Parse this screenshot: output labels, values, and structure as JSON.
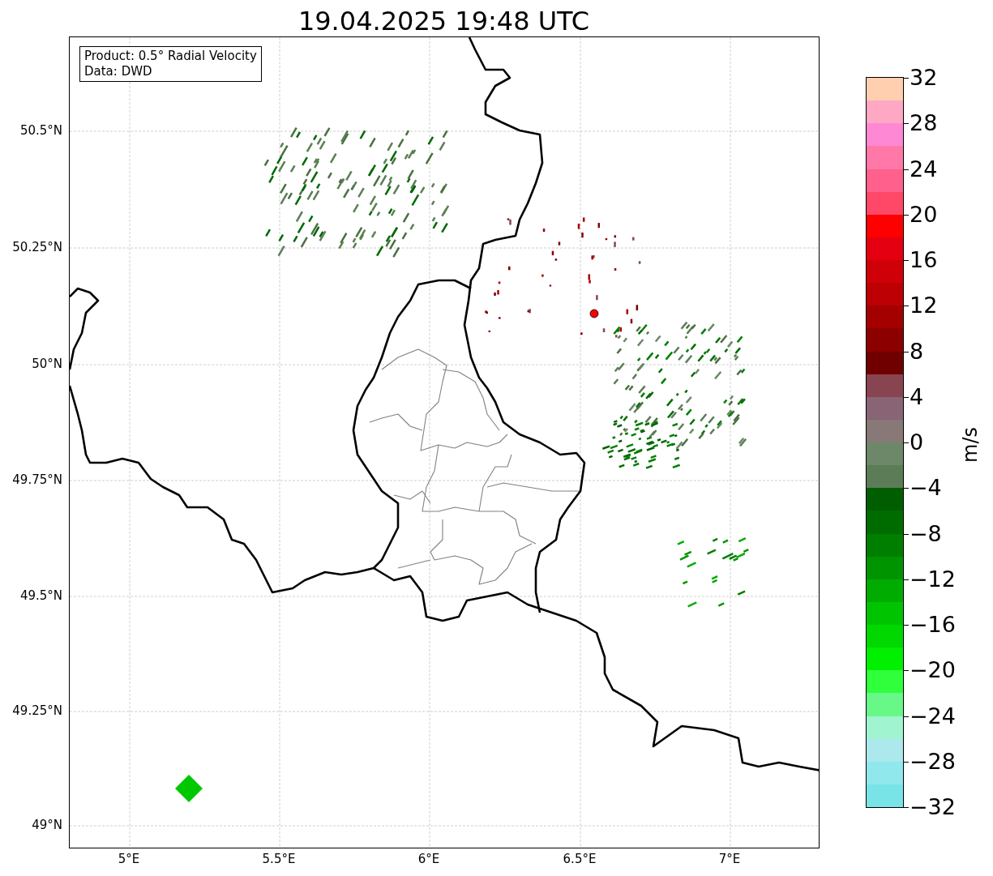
{
  "title": "19.04.2025 19:48 UTC",
  "info_box": [
    "Product: 0.5° Radial Velocity",
    "Data: DWD"
  ],
  "lat_ticks": [
    "50.5°N",
    "50.25°N",
    "50°N",
    "49.75°N",
    "49.5°N",
    "49.25°N",
    "49°N"
  ],
  "lon_ticks": [
    "5°E",
    "5.5°E",
    "6°E",
    "6.5°E",
    "7°E"
  ],
  "colorbar": {
    "label": "m/s",
    "ticks": [
      "32",
      "28",
      "24",
      "20",
      "16",
      "12",
      "8",
      "4",
      "0",
      "−4",
      "−8",
      "−12",
      "−16",
      "−20",
      "−24",
      "−28",
      "−32"
    ],
    "bins": [
      {
        "color": "#ffcfb0"
      },
      {
        "color": "#ffa8c4"
      },
      {
        "color": "#ff88d4"
      },
      {
        "color": "#ff78a8"
      },
      {
        "color": "#ff608c"
      },
      {
        "color": "#ff4868"
      },
      {
        "color": "#ff0000"
      },
      {
        "color": "#e40010"
      },
      {
        "color": "#d00008"
      },
      {
        "color": "#bc0004"
      },
      {
        "color": "#a40000"
      },
      {
        "color": "#8c0000"
      },
      {
        "color": "#700000"
      },
      {
        "color": "#884450"
      },
      {
        "color": "#886474"
      },
      {
        "color": "#887878"
      },
      {
        "color": "#6c8868"
      },
      {
        "color": "#5c7c58"
      },
      {
        "color": "#005e00"
      },
      {
        "color": "#006c00"
      },
      {
        "color": "#007e00"
      },
      {
        "color": "#009400"
      },
      {
        "color": "#00ac00"
      },
      {
        "color": "#00c400"
      },
      {
        "color": "#00d800"
      },
      {
        "color": "#00f000"
      },
      {
        "color": "#30ff3c"
      },
      {
        "color": "#68f888"
      },
      {
        "color": "#a0f4d0"
      },
      {
        "color": "#ace8ec"
      },
      {
        "color": "#90e8ec"
      },
      {
        "color": "#78e4e8"
      }
    ]
  }
}
